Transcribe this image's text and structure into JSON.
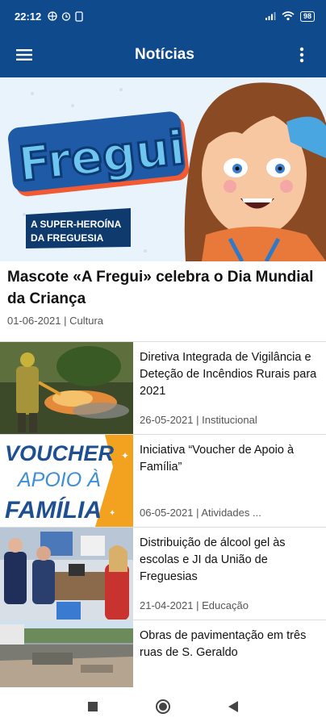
{
  "status": {
    "time": "22:12",
    "battery": "98"
  },
  "appbar": {
    "title": "Notícias"
  },
  "hero": {
    "logo_text": "Fregui",
    "badge_line1": "A SUPER-HEROÍNA",
    "badge_line2": "DA FREGUESIA",
    "title": "Mascote «A Fregui» celebra o Dia Mundial da Criança",
    "meta": "01-06-2021 | Cultura"
  },
  "news": [
    {
      "title": "Diretiva Integrada de Vigilância e Deteção de Incêndios Rurais para 2021",
      "meta": "26-05-2021 | Institucional"
    },
    {
      "title": "Iniciativa “Voucher de Apoio à Família”",
      "meta": "06-05-2021 | Atividades ...",
      "thumb_line1": "VOUCHER",
      "thumb_line2": "APOIO À",
      "thumb_line3": "FAMÍLIA"
    },
    {
      "title": "Distribuição de álcool gel às escolas e JI da União de Freguesias",
      "meta": "21-04-2021 | Educação"
    },
    {
      "title": "Obras de pavimentação em três ruas de S. Geraldo",
      "meta": ""
    }
  ],
  "colors": {
    "primary": "#0f4a8c",
    "hero_bg": "#e9f3fb",
    "voucher_orange": "#f2a21f"
  },
  "icons": {
    "menu": "menu-icon",
    "more": "more-vert-icon",
    "back": "back-icon",
    "home": "home-icon",
    "recents": "recents-icon"
  }
}
